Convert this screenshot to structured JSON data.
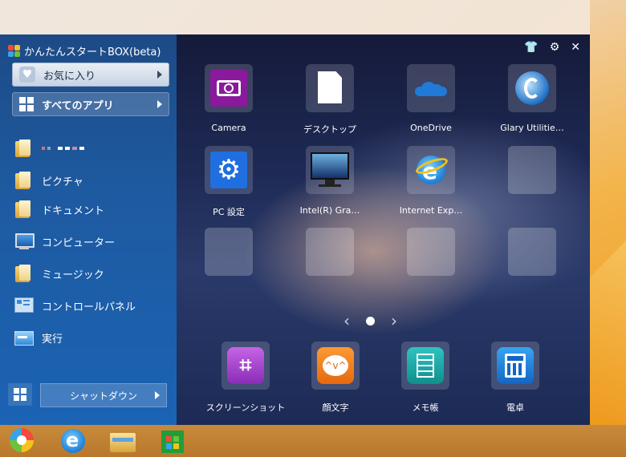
{
  "app": {
    "title": "かんたんスタートBOX(beta)"
  },
  "sidebar": {
    "favorites_label": "お気に入り",
    "all_apps_label": "すべてのアプリ",
    "user_name": "",
    "items": [
      {
        "label": "ピクチャ"
      },
      {
        "label": "ドキュメント"
      },
      {
        "label": "コンピューター"
      },
      {
        "label": "ミュージック"
      },
      {
        "label": "コントロールパネル"
      },
      {
        "label": "実行"
      }
    ],
    "shutdown_label": "シャットダウン"
  },
  "grid": {
    "apps": [
      {
        "label": "Camera",
        "icon": "camera-icon"
      },
      {
        "label": "デスクトップ",
        "icon": "document-icon"
      },
      {
        "label": "OneDrive",
        "icon": "cloud-icon"
      },
      {
        "label": "Glary Utilitie…",
        "icon": "glary-utilities-icon"
      },
      {
        "label": "PC 設定",
        "icon": "gear-icon"
      },
      {
        "label": "Intel(R) Gra…",
        "icon": "monitor-icon"
      },
      {
        "label": "Internet Exp…",
        "icon": "internet-explorer-icon"
      }
    ],
    "page_indicator": {
      "current": 1,
      "total": 1
    }
  },
  "dock": {
    "apps": [
      {
        "label": "スクリーンショット",
        "icon": "crop-icon",
        "color": "#9b3dc0"
      },
      {
        "label": "顔文字",
        "icon": "emoticon-icon",
        "color": "#f07a1a"
      },
      {
        "label": "メモ帳",
        "icon": "notepad-icon",
        "color": "#1aa3a0"
      },
      {
        "label": "電卓",
        "icon": "calculator-icon",
        "color": "#1f84d8"
      }
    ]
  },
  "taskbar": {
    "items": [
      {
        "icon": "start-box-icon"
      },
      {
        "icon": "internet-explorer-icon"
      },
      {
        "icon": "file-explorer-icon"
      },
      {
        "icon": "store-icon"
      }
    ]
  }
}
